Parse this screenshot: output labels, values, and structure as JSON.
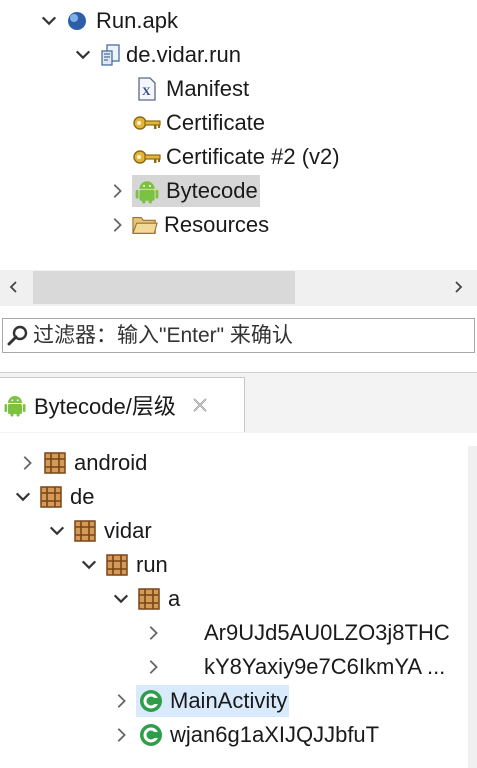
{
  "top_tree": {
    "apk": "Run.apk",
    "package": "de.vidar.run",
    "manifest": "Manifest",
    "cert1": "Certificate",
    "cert2": "Certificate #2 (v2)",
    "bytecode": "Bytecode",
    "resources": "Resources"
  },
  "filter": {
    "placeholder": "过滤器：输入\"Enter\" 来确认"
  },
  "tab": {
    "title": "Bytecode/层级"
  },
  "bytecode_tree": {
    "android": "android",
    "de": "de",
    "vidar": "vidar",
    "run": "run",
    "a": "a",
    "class1": "Ar9UJd5AU0LZO3j8THC",
    "class2": "kY8Yaxiy9e7C6IkmYA ...",
    "main": "MainActivity",
    "other": "wjan6g1aXIJQJJbfuT"
  },
  "colors": {
    "selection_gray": "#d6d6d6",
    "selection_blue": "#d8eafc",
    "android_green": "#7cc242",
    "class_green": "#2e9e4a",
    "package_brown": "#a3652d"
  }
}
